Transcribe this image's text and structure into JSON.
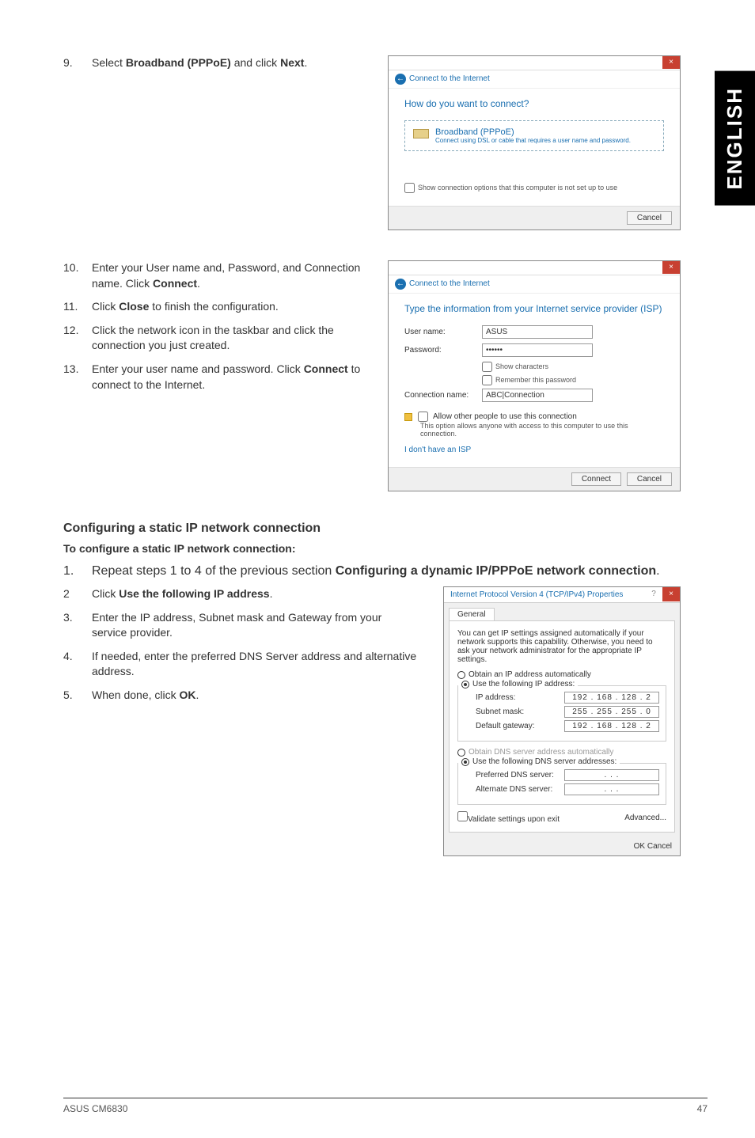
{
  "sideTab": "ENGLISH",
  "steps_top": {
    "n9": "9.",
    "t9a": "Select ",
    "t9b": "Broadband (PPPoE)",
    "t9c": " and click ",
    "t9d": "Next",
    "t9e": "."
  },
  "win1": {
    "crumb": "Connect to the Internet",
    "heading": "How do you want to connect?",
    "opt_title": "Broadband (PPPoE)",
    "opt_sub": "Connect using DSL or cable that requires a user name and password.",
    "chk": "Show connection options that this computer is not set up to use",
    "cancel": "Cancel"
  },
  "steps_mid": {
    "n10": "10.",
    "t10": "Enter your User name and, Password, and Connection name. Click ",
    "t10b": "Connect",
    "t10c": ".",
    "n11": "11.",
    "t11": "Click ",
    "t11b": "Close",
    "t11c": " to finish the configuration.",
    "n12": "12.",
    "t12": "Click the network icon in the taskbar and click the connection you just created.",
    "n13": "13.",
    "t13": "Enter your user name and password. Click ",
    "t13b": "Connect",
    "t13c": " to connect to the Internet."
  },
  "win2": {
    "crumb": "Connect to the Internet",
    "heading": "Type the information from your Internet service provider (ISP)",
    "user_label": "User name:",
    "user_val": "ASUS",
    "pass_label": "Password:",
    "pass_val": "••••••",
    "show_chars": "Show characters",
    "remember": "Remember this password",
    "conn_label": "Connection name:",
    "conn_val": "ABC|Connection",
    "allow": "Allow other people to use this connection",
    "allow_sub": "This option allows anyone with access to this computer to use this connection.",
    "noisp": "I don't have an ISP",
    "connect": "Connect",
    "cancel": "Cancel"
  },
  "section": {
    "h3": "Configuring a static IP network connection",
    "sub": "To configure a static IP network connection:"
  },
  "steps_bot": {
    "n1": "1.",
    "t1a": "Repeat steps 1 to 4 of the previous section ",
    "t1b": "Configuring a dynamic IP/PPPoE network connection",
    "t1c": ".",
    "n2": "2",
    "t2a": "Click ",
    "t2b": "Use the following IP address",
    "t2c": ".",
    "n3": "3.",
    "t3": "Enter the IP address, Subnet mask and Gateway from your service provider.",
    "n4": "4.",
    "t4": "If needed, enter the preferred DNS Server address and alternative address.",
    "n5": "5.",
    "t5a": "When done, click ",
    "t5b": "OK",
    "t5c": "."
  },
  "ipwin": {
    "title": "Internet Protocol Version 4 (TCP/IPv4) Properties",
    "tab": "General",
    "para": "You can get IP settings assigned automatically if your network supports this capability. Otherwise, you need to ask your network administrator for the appropriate IP settings.",
    "r_auto_ip": "Obtain an IP address automatically",
    "r_use_ip": "Use the following IP address:",
    "ip_label": "IP address:",
    "ip_val": "192 . 168 . 128 .  2",
    "sub_label": "Subnet mask:",
    "sub_val": "255 . 255 . 255 .  0",
    "gw_label": "Default gateway:",
    "gw_val": "192 . 168 . 128 .  2",
    "r_auto_dns": "Obtain DNS server address automatically",
    "r_use_dns": "Use the following DNS server addresses:",
    "pref_label": "Preferred DNS server:",
    "pref_val": ".       .       .",
    "alt_label": "Alternate DNS server:",
    "alt_val": ".       .       .",
    "validate": "Validate settings upon exit",
    "adv": "Advanced...",
    "ok": "OK",
    "cancel": "Cancel"
  },
  "footer": {
    "left": "ASUS CM6830",
    "right": "47"
  }
}
